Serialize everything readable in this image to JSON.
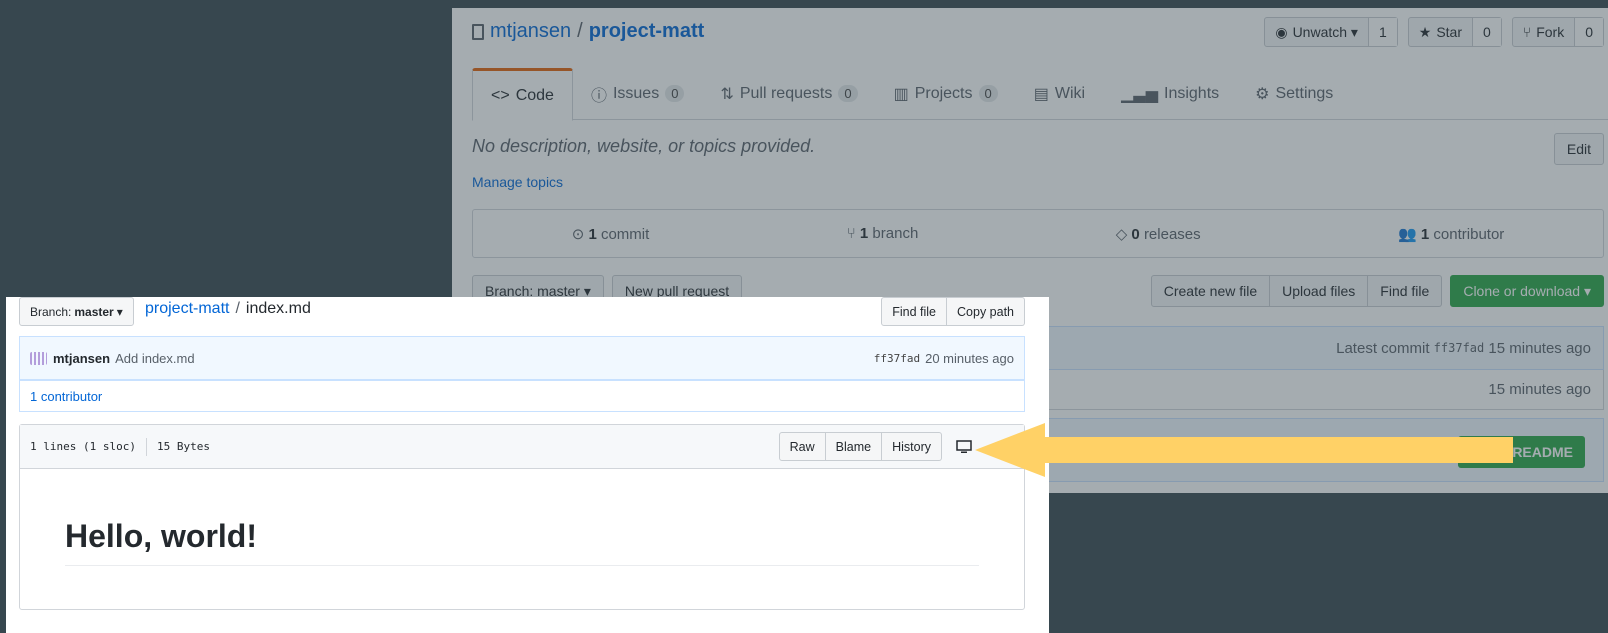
{
  "background_repo": {
    "owner": "mtjansen",
    "repo": "project-matt",
    "header_buttons": [
      {
        "label": "Unwatch ▾",
        "count": "1"
      },
      {
        "label": "Star",
        "count": "0"
      },
      {
        "label": "Fork",
        "count": "0"
      }
    ],
    "tabs": [
      {
        "label": "Code",
        "count": ""
      },
      {
        "label": "Issues",
        "count": "0"
      },
      {
        "label": "Pull requests",
        "count": "0"
      },
      {
        "label": "Projects",
        "count": "0"
      },
      {
        "label": "Wiki",
        "count": ""
      },
      {
        "label": "Insights",
        "count": ""
      },
      {
        "label": "Settings",
        "count": ""
      }
    ],
    "description": "No description, website, or topics provided.",
    "manage_topics": "Manage topics",
    "edit": "Edit",
    "summary": {
      "commits_num": "1",
      "commits_label": "commit",
      "branches_num": "1",
      "branches_label": "branch",
      "releases_num": "0",
      "releases_label": "releases",
      "contributors_num": "1",
      "contributors_label": "contributor"
    },
    "branch_button": "Branch: master ▾",
    "new_pr_button": "New pull request",
    "create_file": "Create new file",
    "upload_files": "Upload files",
    "find_file": "Find file",
    "clone": "Clone or download ▾",
    "latest_commit_label": "Latest commit",
    "latest_commit_sha": "ff37fad",
    "latest_commit_time": "15 minutes ago",
    "file_row_time": "15 minutes ago",
    "readme_button": "Add a README"
  },
  "file_page": {
    "branch_label": "Branch:",
    "branch_name": "master",
    "repo": "project-matt",
    "sep": "/",
    "file": "index.md",
    "find_file": "Find file",
    "copy_path": "Copy path",
    "commit_user": "mtjansen",
    "commit_message": "Add index.md",
    "commit_sha": "ff37fad",
    "commit_time": "20 minutes ago",
    "contributors": "1 contributor",
    "lines": "1 lines (1 sloc)",
    "size": "15 Bytes",
    "raw": "Raw",
    "blame": "Blame",
    "history": "History",
    "heading": "Hello, world!"
  },
  "colors": {
    "arrow": "#ffd166",
    "link": "#0366d6",
    "green": "#28a745",
    "backdrop": "#37474f"
  },
  "icons": [
    "repo-icon",
    "eye-icon",
    "star-icon",
    "fork-icon",
    "code-icon",
    "issue-icon",
    "pr-icon",
    "project-icon",
    "wiki-icon",
    "graph-icon",
    "gear-icon",
    "commit-icon",
    "branch-icon",
    "tag-icon",
    "people-icon",
    "monitor-icon",
    "pencil-icon"
  ]
}
